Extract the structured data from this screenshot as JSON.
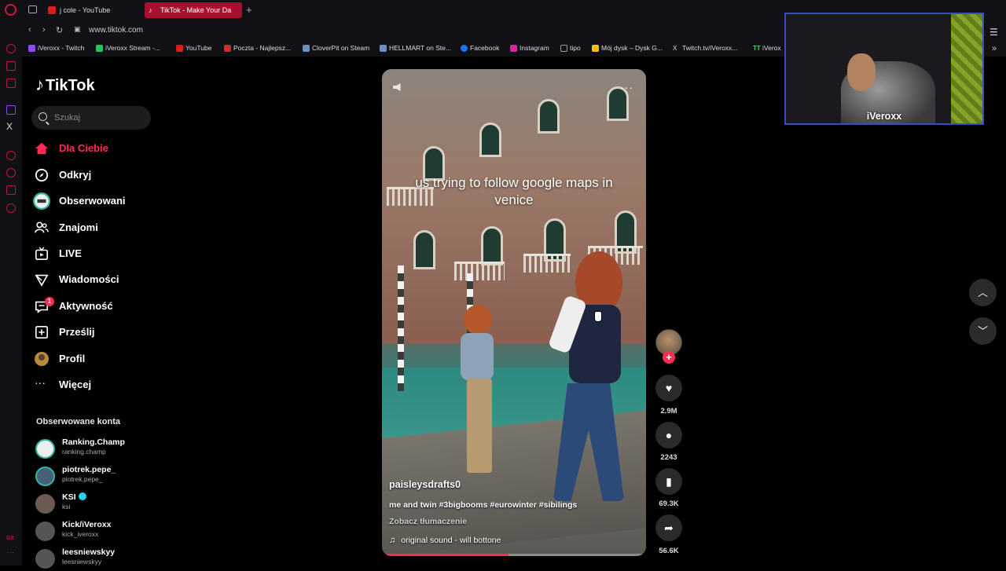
{
  "browser": {
    "tabs": [
      {
        "label": "j cole - YouTube",
        "fav_color": "#e01a1a"
      },
      {
        "label": "TikTok - Make Your Da",
        "fav_color": "#ffffff"
      }
    ],
    "new_tab": "+",
    "url": "www.tiktok.com",
    "bookmarks": [
      {
        "label": "iVeroxx - Twitch",
        "color": "#9146ff"
      },
      {
        "label": "iVeroxx Stream -...",
        "color": "#22c55e"
      },
      {
        "label": "YouTube",
        "color": "#e01a1a"
      },
      {
        "label": "Poczta - Najlepsz...",
        "color": "#d12a2a"
      },
      {
        "label": "CloverPit on Steam",
        "color": "#6a8fc0"
      },
      {
        "label": "HELLMART on Ste...",
        "color": "#6a8fc0"
      },
      {
        "label": "Facebook",
        "color": "#1877f2"
      },
      {
        "label": "Instagram",
        "color": "#d6249f"
      },
      {
        "label": "tipo",
        "color": "#999999"
      },
      {
        "label": "Mój dysk – Dysk G...",
        "color": "#fbbc04"
      },
      {
        "label": "Twitch.tv/iVeroxx...",
        "color": "#dddddd"
      },
      {
        "label": "iVerox",
        "color": "#3ad07a"
      }
    ]
  },
  "tiktok": {
    "logo": "TikTok",
    "search_placeholder": "Szukaj",
    "nav": [
      {
        "label": "Dla Ciebie",
        "icon": "home-icon"
      },
      {
        "label": "Odkryj",
        "icon": "compass-icon"
      },
      {
        "label": "Obserwowani",
        "icon": "following-avatar-icon"
      },
      {
        "label": "Znajomi",
        "icon": "friends-icon"
      },
      {
        "label": "LIVE",
        "icon": "live-tv-icon"
      },
      {
        "label": "Wiadomości",
        "icon": "messages-icon"
      },
      {
        "label": "Aktywność",
        "icon": "activity-icon",
        "badge": "1"
      },
      {
        "label": "Prześlij",
        "icon": "upload-icon"
      },
      {
        "label": "Profil",
        "icon": "profile-avatar-icon"
      },
      {
        "label": "Więcej",
        "icon": "more-icon"
      }
    ],
    "following_heading": "Obserwowane konta",
    "following": [
      {
        "name": "Ranking.Champ",
        "handle": "ranking.champ"
      },
      {
        "name": "piotrek.pepe_",
        "handle": "piotrek.pepe_"
      },
      {
        "name": "KSI",
        "handle": "ksi",
        "verified": true
      },
      {
        "name": "Kick/iVeroxx",
        "handle": "kick_iveroxx"
      },
      {
        "name": "leesniewskyy",
        "handle": "leesniewskyy"
      }
    ]
  },
  "video": {
    "caption": "us trying to follow google maps in venice",
    "author": "paisleysdrafts0",
    "description": "me and twin #3bigbooms #eurowinter #sibilings",
    "translate": "Zobacz tłumaczenie",
    "sound": "original sound - will bottone",
    "progress": 0.48,
    "more": "···"
  },
  "actions": {
    "likes": "2.9M",
    "comments": "2243",
    "saves": "69.3K",
    "shares": "56.6K"
  },
  "webcam": {
    "label": "iVeroxx"
  }
}
